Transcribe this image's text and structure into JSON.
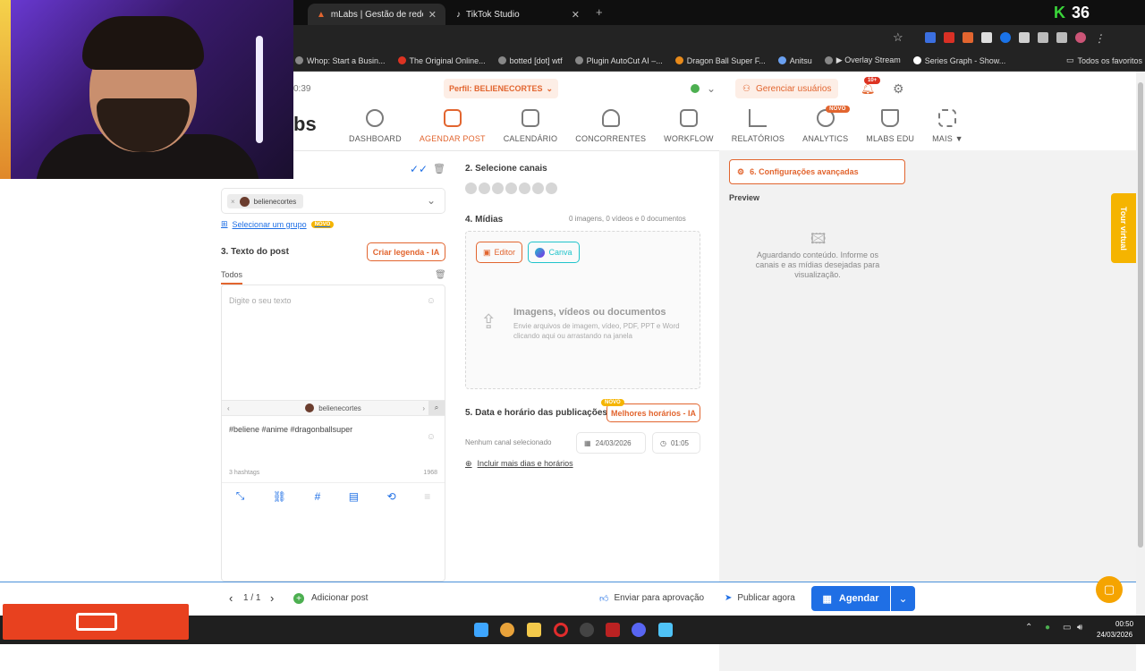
{
  "browser": {
    "tabs": [
      {
        "label": "mLabs | Gestão de redes sociais",
        "active": true
      },
      {
        "label": "TikTok Studio",
        "active": false
      }
    ],
    "bookmarks": [
      "Whop: Start a Busin...",
      "The Original Online...",
      "botted [dot] wtf",
      "Plugin AutoCut AI –...",
      "Dragon Ball Super F...",
      "Anitsu",
      "▶ Overlay Stream",
      "Series Graph - Show..."
    ],
    "favorites_label": "Todos os favoritos",
    "counter": "36"
  },
  "header": {
    "time_left": "0:39",
    "profile_label": "Perfil: BELIENECORTES",
    "manage_users": "Gerenciar usuários",
    "notif_count": "10+",
    "logo_text": "bs"
  },
  "nav": {
    "items": [
      {
        "label": "DASHBOARD",
        "icon": "gauge-icon"
      },
      {
        "label": "AGENDAR POST",
        "icon": "calendar-plus-icon",
        "active": true
      },
      {
        "label": "CALENDÁRIO",
        "icon": "calendar-icon"
      },
      {
        "label": "CONCORRENTES",
        "icon": "person-icon"
      },
      {
        "label": "WORKFLOW",
        "icon": "checklist-icon"
      },
      {
        "label": "RELATÓRIOS",
        "icon": "chart-line-icon"
      },
      {
        "label": "ANALYTICS",
        "icon": "pie-icon"
      },
      {
        "label": "MLABS EDU",
        "icon": "graduation-cap-icon"
      },
      {
        "label": "MAIS ▼",
        "icon": "grid-plus-icon"
      }
    ],
    "new_badge": "NOVO"
  },
  "left": {
    "profile_chip": "belienecortes",
    "select_group": "Selecionar um grupo",
    "select_group_badge": "NOVO",
    "section_text_title": "3. Texto do post",
    "create_caption_btn": "Criar legenda - IA",
    "all_tab": "Todos",
    "text_placeholder": "Digite o seu texto",
    "account_name": "belienecortes",
    "hashtag_text": "#beliene #anime #dragonballsuper",
    "hashtag_count": "3 hashtags",
    "char_count": "1968"
  },
  "middle": {
    "channels_title": "2. Selecione canais",
    "media_title": "4. Mídias",
    "media_counts": "0 imagens, 0 vídeos e 0 documentos",
    "editor_btn": "Editor",
    "canva_btn": "Canva",
    "upload_title": "Imagens, vídeos ou documentos",
    "upload_desc": "Envie arquivos de imagem, vídeo, PDF, PPT e Word clicando aqui ou arrastando na janela",
    "schedule_title": "5. Data e horário das publicações",
    "best_times_btn": "Melhores horários - IA",
    "best_times_badge": "NOVO",
    "no_channel": "Nenhum canal selecionado",
    "date": "24/03/2026",
    "time": "01:05",
    "include_more": "Incluir mais dias e horários"
  },
  "right": {
    "advanced_btn": "6. Configurações avançadas",
    "preview_title": "Preview",
    "preview_msg": "Aguardando conteúdo. Informe os canais e as mídias desejadas para visualização.",
    "tour_tab": "Tour virtual"
  },
  "bottom": {
    "pager": "1 / 1",
    "add_post": "Adicionar post",
    "send_approval": "Enviar para aprovação",
    "publish_now": "Publicar agora",
    "schedule_btn": "Agendar"
  },
  "taskbar": {
    "clock_time": "00:50",
    "clock_date": "24/03/2026"
  },
  "colors": {
    "accent": "#e2652f",
    "primary_blue": "#1f6fe5",
    "panel_bg": "#f2f2f2"
  }
}
